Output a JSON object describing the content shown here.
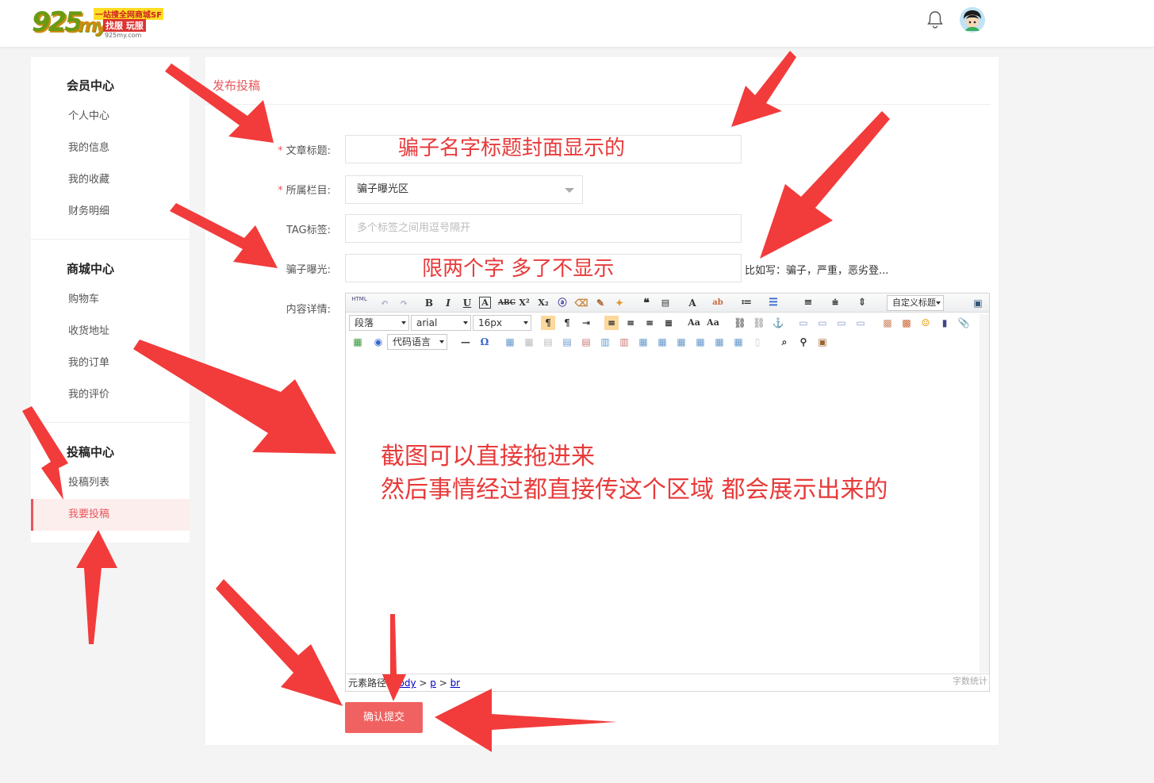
{
  "header": {
    "logo_number": "925",
    "logo_my": "my",
    "logo_tag1": "一站搜全网商城SF",
    "logo_tag2": "找服 玩服",
    "logo_url": "925my.com"
  },
  "sidebar": {
    "groups": [
      {
        "title": "会员中心",
        "items": [
          "个人中心",
          "我的信息",
          "我的收藏",
          "财务明细"
        ]
      },
      {
        "title": "商城中心",
        "items": [
          "购物车",
          "收货地址",
          "我的订单",
          "我的评价"
        ]
      },
      {
        "title": "投稿中心",
        "items": [
          "投稿列表",
          "我要投稿"
        ]
      }
    ],
    "active_item": "我要投稿"
  },
  "main": {
    "page_title": "发布投稿",
    "form": {
      "title_label": "文章标题:",
      "category_label": "所属栏目:",
      "category_value": "骗子曝光区",
      "tag_label": "TAG标签:",
      "tag_placeholder": "多个标签之间用逗号隔开",
      "scammer_label": "骗子曝光:",
      "scammer_hint": "比如写：骗子，严重，恶劣登...",
      "content_label": "内容详情:",
      "required_mark": "*"
    },
    "editor": {
      "toolbar_html": "HTML",
      "paragraph_select": "段落",
      "font_select": "arial",
      "size_select": "16px",
      "custom_title_select": "自定义标题",
      "code_lang_select": "代码语言",
      "status_path_label": "元素路径:",
      "status_path": [
        "body",
        "p",
        "br"
      ],
      "word_count": "字数统计"
    },
    "submit_label": "确认提交"
  },
  "annotations": {
    "title_note": "骗子名字标题封面显示的",
    "scammer_note": "限两个字 多了不显示",
    "content_note_line1": "截图可以直接拖进来",
    "content_note_line2": "然后事情经过都直接传这个区域 都会展示出来的"
  },
  "colors": {
    "accent": "#e9575b",
    "annotation_red": "#f23b3b",
    "submit_bg": "#f06262"
  }
}
